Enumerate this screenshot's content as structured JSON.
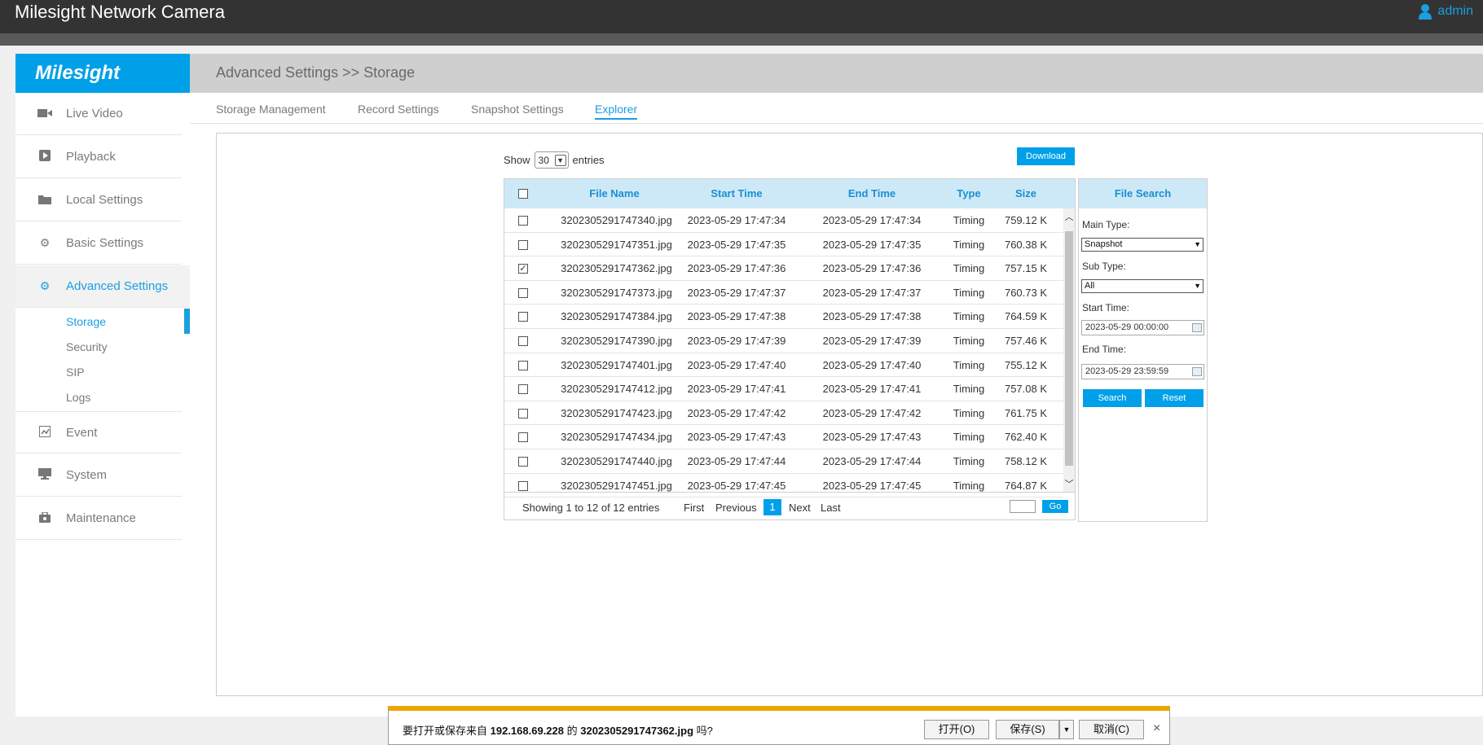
{
  "window": {
    "title": "Milesight Network Camera",
    "user": "admin"
  },
  "brand": {
    "logo_text": "Milesight",
    "accent": "#00a0e9"
  },
  "sidebar": {
    "items": [
      {
        "label": "Live Video",
        "icon": "video-camera-icon"
      },
      {
        "label": "Playback",
        "icon": "play-icon"
      },
      {
        "label": "Local Settings",
        "icon": "folder-icon"
      },
      {
        "label": "Basic Settings",
        "icon": "gear-icon"
      },
      {
        "label": "Advanced Settings",
        "icon": "gears-icon",
        "active": true
      },
      {
        "label": "Event",
        "icon": "event-icon"
      },
      {
        "label": "System",
        "icon": "monitor-icon"
      },
      {
        "label": "Maintenance",
        "icon": "toolbox-icon"
      }
    ],
    "subitems": [
      {
        "label": "Storage",
        "active": true
      },
      {
        "label": "Security"
      },
      {
        "label": "SIP"
      },
      {
        "label": "Logs"
      }
    ]
  },
  "header": {
    "breadcrumb": "Advanced Settings >> Storage"
  },
  "tabs": [
    {
      "label": "Storage Management"
    },
    {
      "label": "Record Settings"
    },
    {
      "label": "Snapshot Settings"
    },
    {
      "label": "Explorer",
      "active": true
    }
  ],
  "list": {
    "show_label": "Show",
    "entries_value": "30",
    "entries_label": "entries",
    "download_label": "Download",
    "columns": [
      "File Name",
      "Start Time",
      "End Time",
      "Type",
      "Size"
    ],
    "rows": [
      {
        "name": "3202305291747340.jpg",
        "start": "2023-05-29 17:47:34",
        "end": "2023-05-29 17:47:34",
        "type": "Timing",
        "size": "759.12 K",
        "checked": false
      },
      {
        "name": "3202305291747351.jpg",
        "start": "2023-05-29 17:47:35",
        "end": "2023-05-29 17:47:35",
        "type": "Timing",
        "size": "760.38 K",
        "checked": false
      },
      {
        "name": "3202305291747362.jpg",
        "start": "2023-05-29 17:47:36",
        "end": "2023-05-29 17:47:36",
        "type": "Timing",
        "size": "757.15 K",
        "checked": true
      },
      {
        "name": "3202305291747373.jpg",
        "start": "2023-05-29 17:47:37",
        "end": "2023-05-29 17:47:37",
        "type": "Timing",
        "size": "760.73 K",
        "checked": false
      },
      {
        "name": "3202305291747384.jpg",
        "start": "2023-05-29 17:47:38",
        "end": "2023-05-29 17:47:38",
        "type": "Timing",
        "size": "764.59 K",
        "checked": false
      },
      {
        "name": "3202305291747390.jpg",
        "start": "2023-05-29 17:47:39",
        "end": "2023-05-29 17:47:39",
        "type": "Timing",
        "size": "757.46 K",
        "checked": false
      },
      {
        "name": "3202305291747401.jpg",
        "start": "2023-05-29 17:47:40",
        "end": "2023-05-29 17:47:40",
        "type": "Timing",
        "size": "755.12 K",
        "checked": false
      },
      {
        "name": "3202305291747412.jpg",
        "start": "2023-05-29 17:47:41",
        "end": "2023-05-29 17:47:41",
        "type": "Timing",
        "size": "757.08 K",
        "checked": false
      },
      {
        "name": "3202305291747423.jpg",
        "start": "2023-05-29 17:47:42",
        "end": "2023-05-29 17:47:42",
        "type": "Timing",
        "size": "761.75 K",
        "checked": false
      },
      {
        "name": "3202305291747434.jpg",
        "start": "2023-05-29 17:47:43",
        "end": "2023-05-29 17:47:43",
        "type": "Timing",
        "size": "762.40 K",
        "checked": false
      },
      {
        "name": "3202305291747440.jpg",
        "start": "2023-05-29 17:47:44",
        "end": "2023-05-29 17:47:44",
        "type": "Timing",
        "size": "758.12 K",
        "checked": false
      },
      {
        "name": "3202305291747451.jpg",
        "start": "2023-05-29 17:47:45",
        "end": "2023-05-29 17:47:45",
        "type": "Timing",
        "size": "764.87 K",
        "checked": false
      }
    ],
    "footer": {
      "summary": "Showing 1 to 12 of 12 entries",
      "first": "First",
      "previous": "Previous",
      "current_page": "1",
      "next": "Next",
      "last": "Last",
      "go": "Go"
    }
  },
  "search": {
    "title": "File Search",
    "main_type_label": "Main Type:",
    "main_type_value": "Snapshot",
    "sub_type_label": "Sub Type:",
    "sub_type_value": "All",
    "start_label": "Start Time:",
    "start_value": "2023-05-29 00:00:00",
    "end_label": "End Time:",
    "end_value": "2023-05-29 23:59:59",
    "search_btn": "Search",
    "reset_btn": "Reset"
  },
  "download_bar": {
    "msg_prefix": "要打开或保存来自 ",
    "host": "192.168.69.228",
    "msg_mid": " 的 ",
    "file": "3202305291747362.jpg",
    "msg_suffix": " 吗?",
    "open": "打开(O)",
    "save": "保存(S)",
    "cancel": "取消(C)",
    "close": "×"
  }
}
